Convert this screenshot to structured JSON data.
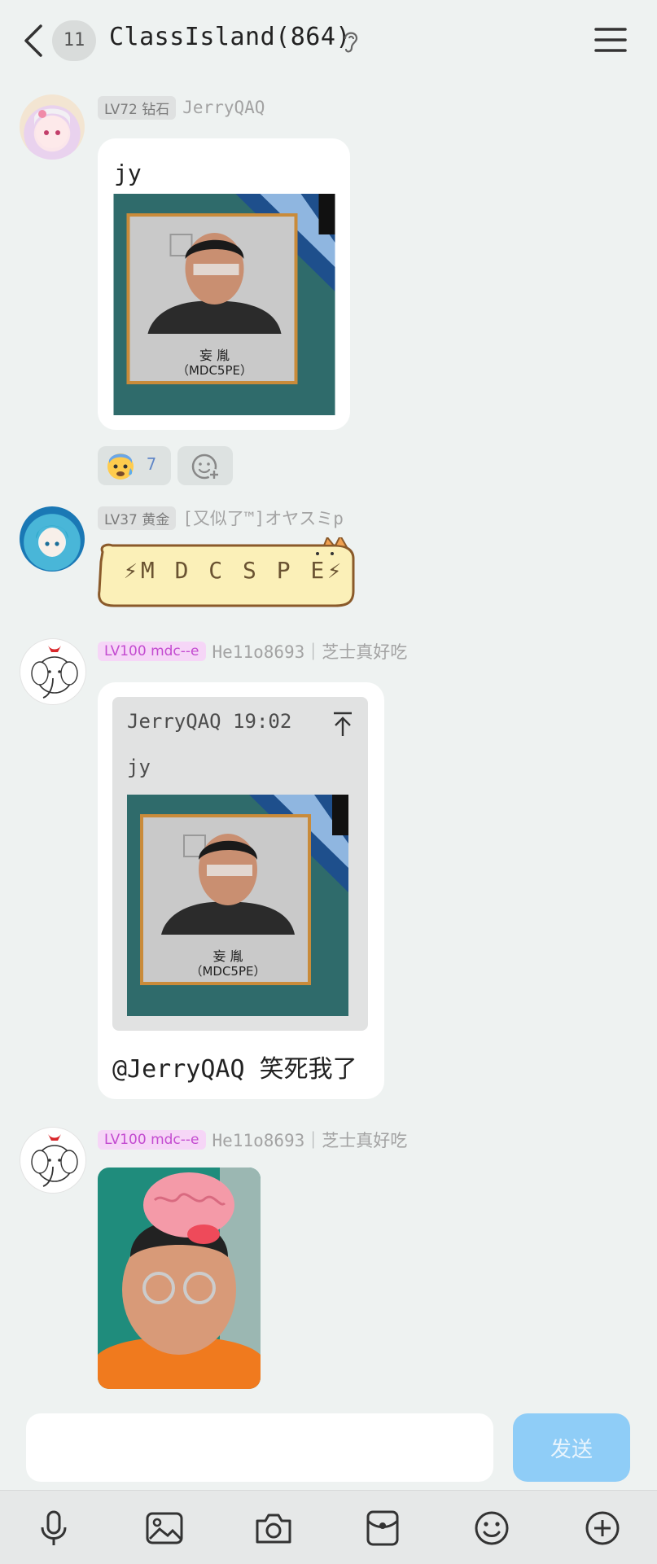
{
  "header": {
    "unread_count": "11",
    "title": "ClassIsland(864)"
  },
  "messages": [
    {
      "level": "LV72 钻石",
      "sender": "JerryQAQ",
      "text": "jy",
      "image_caption_line1": "妄 胤",
      "image_caption_line2": "（MDC5PE）",
      "reaction_count": "7"
    },
    {
      "level": "LV37 黄金",
      "sender": "[又似了™]オヤスミp",
      "text": "⚡M D C S P E⚡"
    },
    {
      "level": "LV100 mdc--e",
      "sender": "He11o8693｜芝士真好吃",
      "quote": {
        "header": "JerryQAQ 19:02",
        "text": "jy",
        "image_caption_line1": "妄 胤",
        "image_caption_line2": "（MDC5PE）"
      },
      "text": "@JerryQAQ 笑死我了"
    },
    {
      "level": "LV100 mdc--e",
      "sender": "He11o8693｜芝士真好吃"
    }
  ],
  "composer": {
    "placeholder": "",
    "send_label": "发送"
  },
  "colors": {
    "background": "#eef2f1",
    "send_button": "#8fcdf7",
    "level_pink": "#c34bd0",
    "reaction_count": "#5f86c7"
  }
}
